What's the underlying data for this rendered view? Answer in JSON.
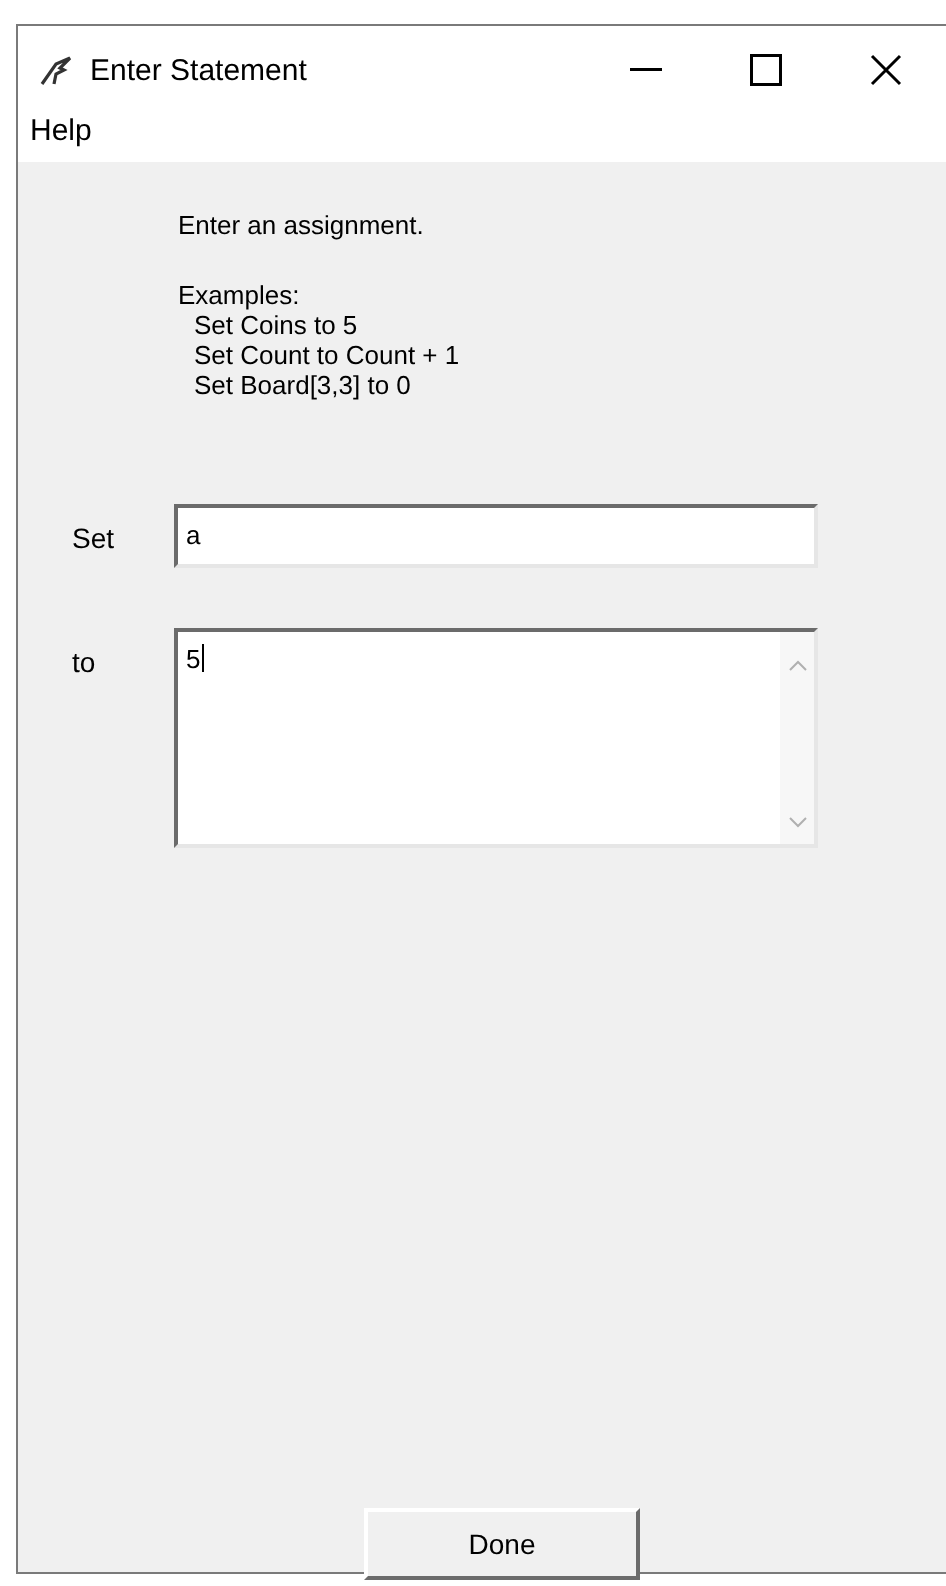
{
  "window": {
    "title": "Enter Statement"
  },
  "menu": [
    "Help"
  ],
  "instructions": "Enter an assignment.",
  "examples_heading": "Examples:",
  "examples": [
    "Set Coins to 5",
    "Set Count to Count + 1",
    "Set Board[3,3] to 0"
  ],
  "set_field": {
    "label": "Set",
    "value": "a"
  },
  "to_field": {
    "label": "to",
    "value": "5"
  },
  "buttons": [
    "Done"
  ]
}
